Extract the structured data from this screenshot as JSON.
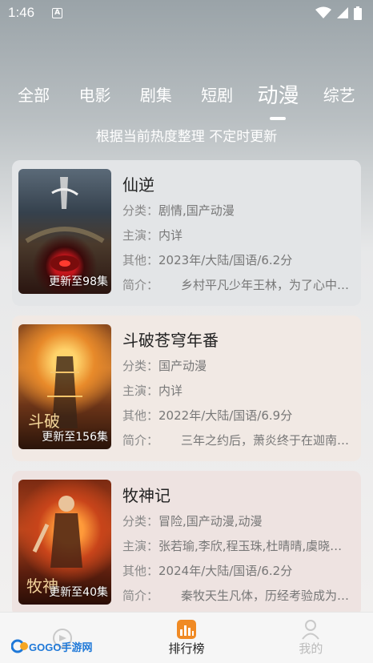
{
  "status": {
    "time": "1:46",
    "indicator": "A"
  },
  "tabs": [
    {
      "label": "全部",
      "active": false
    },
    {
      "label": "电影",
      "active": false
    },
    {
      "label": "剧集",
      "active": false
    },
    {
      "label": "短剧",
      "active": false
    },
    {
      "label": "动漫",
      "active": true
    },
    {
      "label": "综艺",
      "active": false
    }
  ],
  "subtitle": "根据当前热度整理 不定时更新",
  "items": [
    {
      "title": "仙逆",
      "badge": "更新至98集",
      "category_key": "分类：",
      "category": "剧情,国产动漫",
      "cast_key": "主演：",
      "cast": "内详",
      "other_key": "其他：",
      "other": "2023年/大陆/国语/6.2分",
      "intro_key": "简介：",
      "intro": "乡村平凡少年王林，为了心中…",
      "card_color": "#e3e5e7"
    },
    {
      "title": "斗破苍穹年番",
      "badge": "更新至156集",
      "category_key": "分类：",
      "category": "国产动漫",
      "cast_key": "主演：",
      "cast": "内详",
      "other_key": "其他：",
      "other": "2022年/大陆/国语/6.9分",
      "intro_key": "简介：",
      "intro": "三年之约后，萧炎终于在迦南…",
      "card_color": "#f1e9e4"
    },
    {
      "title": "牧神记",
      "badge": "更新至40集",
      "category_key": "分类：",
      "category": "冒险,国产动漫,动漫",
      "cast_key": "主演：",
      "cast": "张若瑜,李欣,程玉珠,杜晴晴,虞晓…",
      "other_key": "其他：",
      "other": "2024年/大陆/国语/6.2分",
      "intro_key": "简介：",
      "intro": "秦牧天生凡体，历经考验成为…",
      "card_color": "#eee3e1"
    }
  ],
  "bottom_nav": [
    {
      "label": "",
      "icon": "home-icon",
      "active": false
    },
    {
      "label": "排行榜",
      "icon": "ranking-icon",
      "active": true
    },
    {
      "label": "我的",
      "icon": "user-icon",
      "active": false
    }
  ],
  "watermark": "GOGO手游网"
}
